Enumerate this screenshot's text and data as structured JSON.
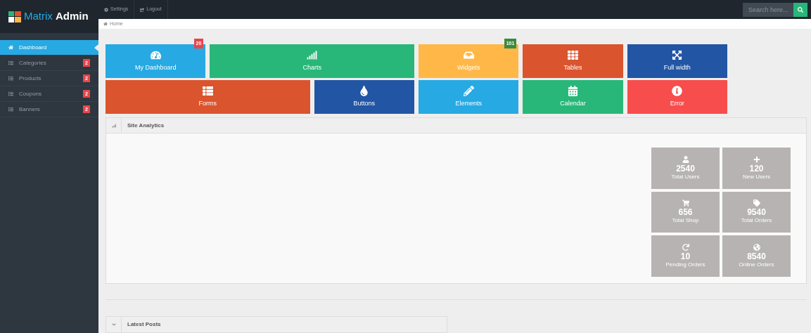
{
  "brand": {
    "light": "Matrix",
    "bold": "Admin"
  },
  "topbar": {
    "links": [
      {
        "label": "Settings"
      },
      {
        "label": "Logout"
      }
    ],
    "search": {
      "placeholder": "Search here..."
    }
  },
  "breadcrumb": [
    "Home"
  ],
  "sidebar": {
    "items": [
      {
        "label": "Dashboard",
        "selected": true
      },
      {
        "label": "Categories",
        "selected": false,
        "badge": "2"
      },
      {
        "label": "Products",
        "selected": false,
        "badge": "2"
      },
      {
        "label": "Coupons",
        "selected": false,
        "badge": "2"
      },
      {
        "label": "Banners",
        "selected": false,
        "badge": "2"
      }
    ]
  },
  "tiles": [
    {
      "label": "My Dashboard",
      "color": "#27a9e3",
      "badge": {
        "text": "20",
        "color": "#e8454c"
      }
    },
    {
      "label": "Charts",
      "color": "#28b779"
    },
    {
      "label": "Widgets",
      "color": "#ffb848",
      "badge": {
        "text": "101",
        "color": "#3a8a3f"
      }
    },
    {
      "label": "Tables",
      "color": "#da542e"
    },
    {
      "label": "Full width",
      "color": "#2255a4"
    },
    {
      "label": "Forms",
      "color": "#da542e"
    },
    {
      "label": "Buttons",
      "color": "#2255a4"
    },
    {
      "label": "Elements",
      "color": "#27a9e3"
    },
    {
      "label": "Calendar",
      "color": "#28b779"
    },
    {
      "label": "Error",
      "color": "#f74d4d"
    }
  ],
  "site_analytics": {
    "title": "Site Analytics",
    "stats": [
      {
        "value": "2540",
        "label": "Total Users"
      },
      {
        "value": "120",
        "label": "New Users"
      },
      {
        "value": "656",
        "label": "Total Shop"
      },
      {
        "value": "9540",
        "label": "Total Orders"
      },
      {
        "value": "10",
        "label": "Pending Orders"
      },
      {
        "value": "8540",
        "label": "Online Orders"
      }
    ]
  },
  "latest_posts": {
    "title": "Latest Posts"
  }
}
